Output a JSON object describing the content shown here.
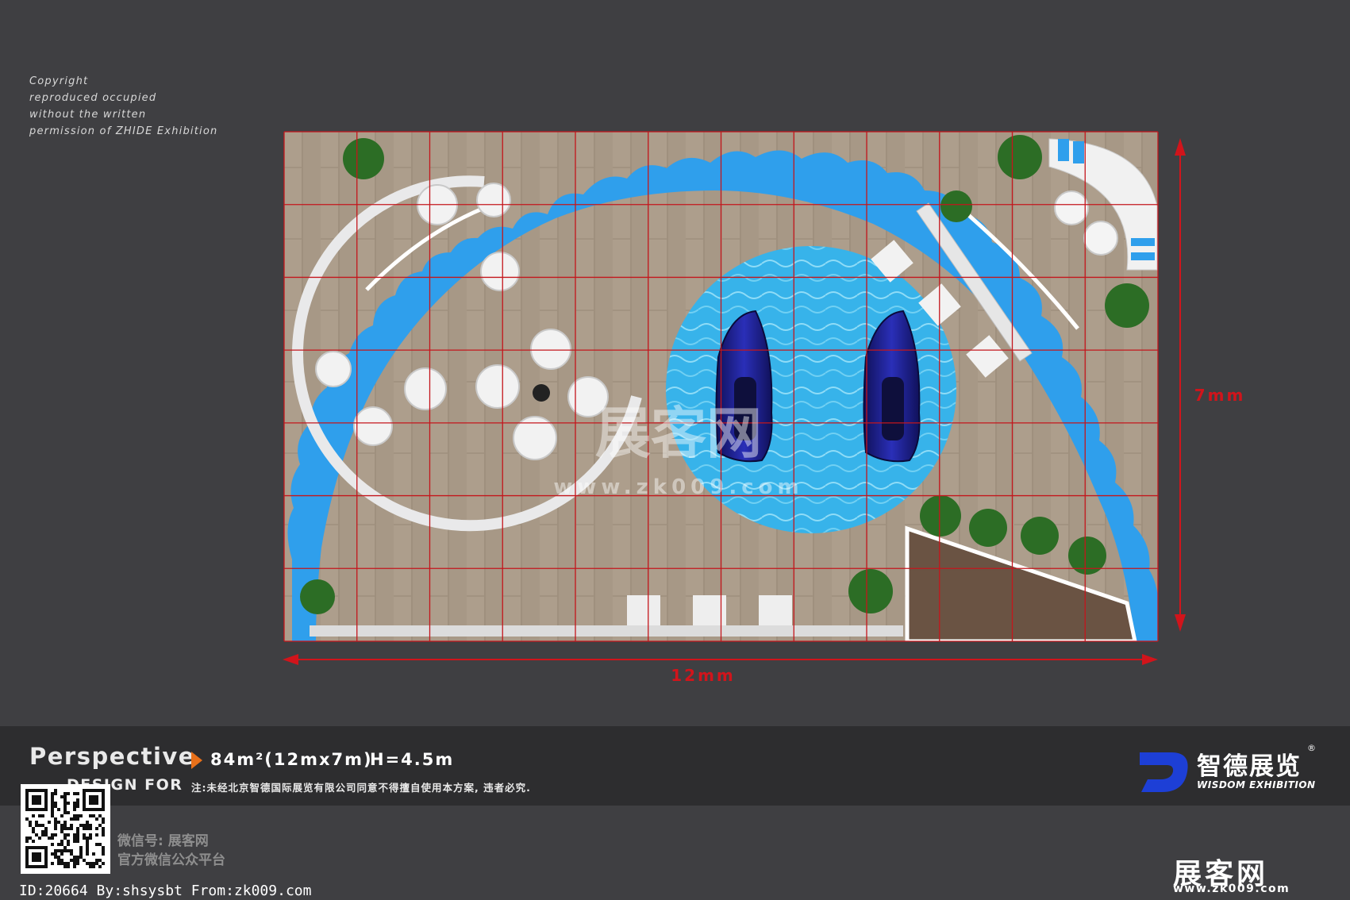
{
  "copyright_lines": [
    "Copyright",
    "reproduced occupied",
    "without the written",
    "permission of ZHIDE Exhibition"
  ],
  "dimension_width": "12mm",
  "dimension_height": "7mm",
  "watermark": {
    "logo": "展客网",
    "url": "www.zk009.com"
  },
  "info_bar": {
    "perspective": "Perspective",
    "area": "84m²(12mx7m)",
    "height": "H=4.5m",
    "design_for": "DESIGN FOR",
    "notice": "注:未经北京智德国际展览有限公司同意不得擅自使用本方案, 违者必究."
  },
  "brand": {
    "name": "智德展览",
    "registered": "®",
    "subtitle": "WISDOM EXHIBITION",
    "accent": "#1d3fd6"
  },
  "wechat": {
    "line1": "微信号: 展客网",
    "line2": "官方微信公众平台"
  },
  "footer_id": "ID:20664 By:shsysbt From:zk009.com",
  "site_logo": {
    "name": "展客网",
    "url": "www.zk009.com"
  },
  "colors": {
    "background": "#3f3f42",
    "floor": "#a59684",
    "wave": "#2f9fec",
    "pool": "#39b5ec",
    "grid": "#c4161c",
    "boat": "#1c1f8a"
  }
}
